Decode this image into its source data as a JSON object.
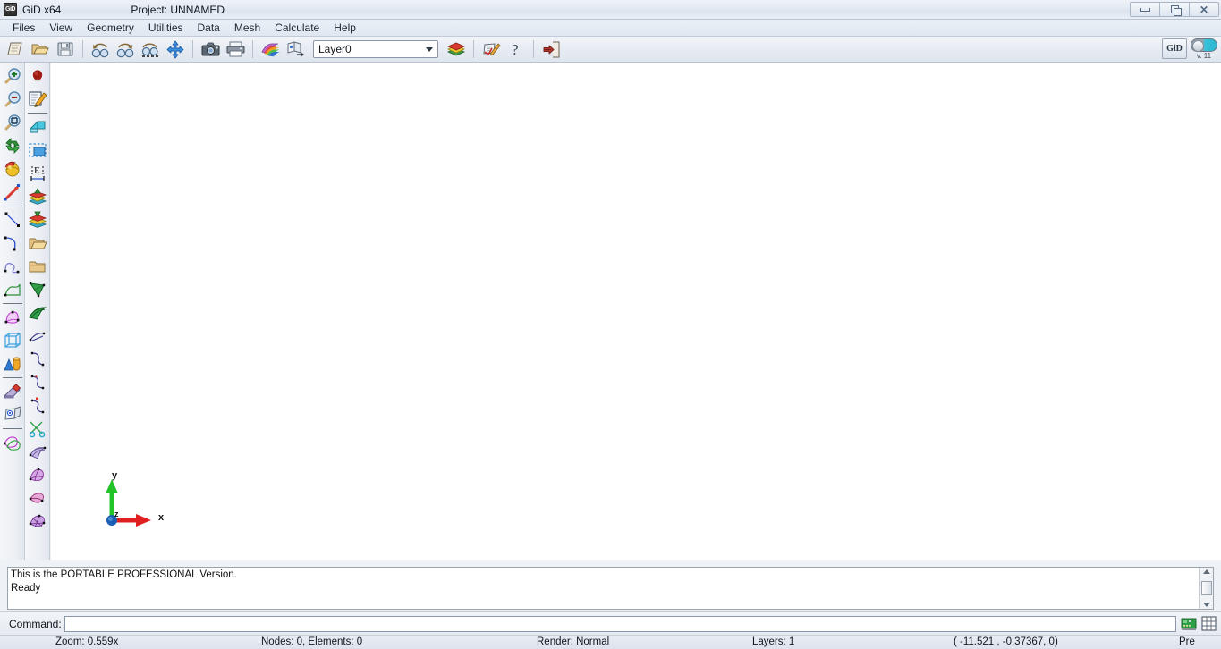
{
  "titlebar": {
    "app_icon": "gid-logo-icon",
    "app_title": "GiD x64",
    "project_label": "Project: UNNAMED",
    "minimize": "minimize-button",
    "maximize": "restore-button",
    "close": "✕"
  },
  "menubar": {
    "items": [
      {
        "label": "Files"
      },
      {
        "label": "View"
      },
      {
        "label": "Geometry"
      },
      {
        "label": "Utilities"
      },
      {
        "label": "Data"
      },
      {
        "label": "Mesh"
      },
      {
        "label": "Calculate"
      },
      {
        "label": "Help"
      }
    ]
  },
  "toolbar": {
    "buttons": [
      {
        "name": "new-file-icon"
      },
      {
        "name": "open-file-icon"
      },
      {
        "name": "save-file-icon"
      },
      {
        "name": "zoom-previous-icon"
      },
      {
        "name": "zoom-next-icon"
      },
      {
        "name": "zoom-window-icon"
      },
      {
        "name": "pan-icon"
      },
      {
        "name": "snapshot-icon"
      },
      {
        "name": "print-icon"
      },
      {
        "name": "render-colors-icon"
      },
      {
        "name": "animate-icon"
      }
    ],
    "layer_select": {
      "value": "Layer0",
      "icon": "layers-icon"
    },
    "after_layer_buttons": [
      {
        "name": "preferences-icon"
      },
      {
        "name": "help-question-icon"
      },
      {
        "name": "exit-icon"
      }
    ],
    "gid_logo_label": "GiD",
    "version_label": "v. 11"
  },
  "sidebar_left": {
    "column1": [
      {
        "name": "zoom-in-icon"
      },
      {
        "name": "zoom-out-icon"
      },
      {
        "name": "zoom-frame-icon"
      },
      {
        "name": "rotate-icon"
      },
      {
        "name": "rotate-trackball-icon"
      },
      {
        "name": "normal-vector-icon"
      },
      {
        "name": "separator"
      },
      {
        "name": "create-line-icon"
      },
      {
        "name": "create-arc-icon"
      },
      {
        "name": "create-nurbs-curve-icon"
      },
      {
        "name": "create-surface-icon"
      },
      {
        "name": "separator"
      },
      {
        "name": "create-nurbs-surface-icon"
      },
      {
        "name": "create-volume-icon"
      },
      {
        "name": "create-object-icon"
      },
      {
        "name": "separator"
      },
      {
        "name": "delete-icon"
      },
      {
        "name": "inspect-icon"
      },
      {
        "name": "separator"
      },
      {
        "name": "copy-transform-icon"
      }
    ],
    "column2": [
      {
        "name": "create-point-icon"
      },
      {
        "name": "edit-icon"
      },
      {
        "name": "separator"
      },
      {
        "name": "label-icon"
      },
      {
        "name": "select-window-icon"
      },
      {
        "name": "measure-distance-icon"
      },
      {
        "name": "layer-raise-icon"
      },
      {
        "name": "layer-lower-icon"
      },
      {
        "name": "open-group-icon"
      },
      {
        "name": "close-group-icon"
      },
      {
        "name": "mesh-surface-icon"
      },
      {
        "name": "mesh-view-icon"
      },
      {
        "name": "mesh-lines-icon"
      },
      {
        "name": "edit-line-icon"
      },
      {
        "name": "edit-curve-icon"
      },
      {
        "name": "edit-curve-point-icon"
      },
      {
        "name": "split-icon"
      },
      {
        "name": "mesh-strip-icon"
      },
      {
        "name": "mesh-quad-icon"
      },
      {
        "name": "mesh-collapse-icon"
      },
      {
        "name": "mesh-refine-icon"
      }
    ]
  },
  "canvas": {
    "axis": {
      "x_label": "x",
      "y_label": "y",
      "z_label": "z",
      "x_color": "#e02020",
      "y_color": "#22c42a",
      "z_color": "#1a5fb4"
    },
    "background_color": "#ffffff"
  },
  "message_log": {
    "lines": [
      "This is the PORTABLE PROFESSIONAL Version.",
      "Ready"
    ]
  },
  "command_bar": {
    "label": "Command:",
    "value": "",
    "placeholder": "",
    "icons": [
      {
        "name": "graphics-hardware-icon"
      },
      {
        "name": "grid-icon"
      }
    ]
  },
  "statusbar": {
    "zoom": "Zoom: 0.559x",
    "counts": "Nodes: 0, Elements: 0",
    "render": "Render: Normal",
    "layers": "Layers: 1",
    "coordinates": "( -11.521 , -0.37367, 0)",
    "mode": "Pre"
  }
}
